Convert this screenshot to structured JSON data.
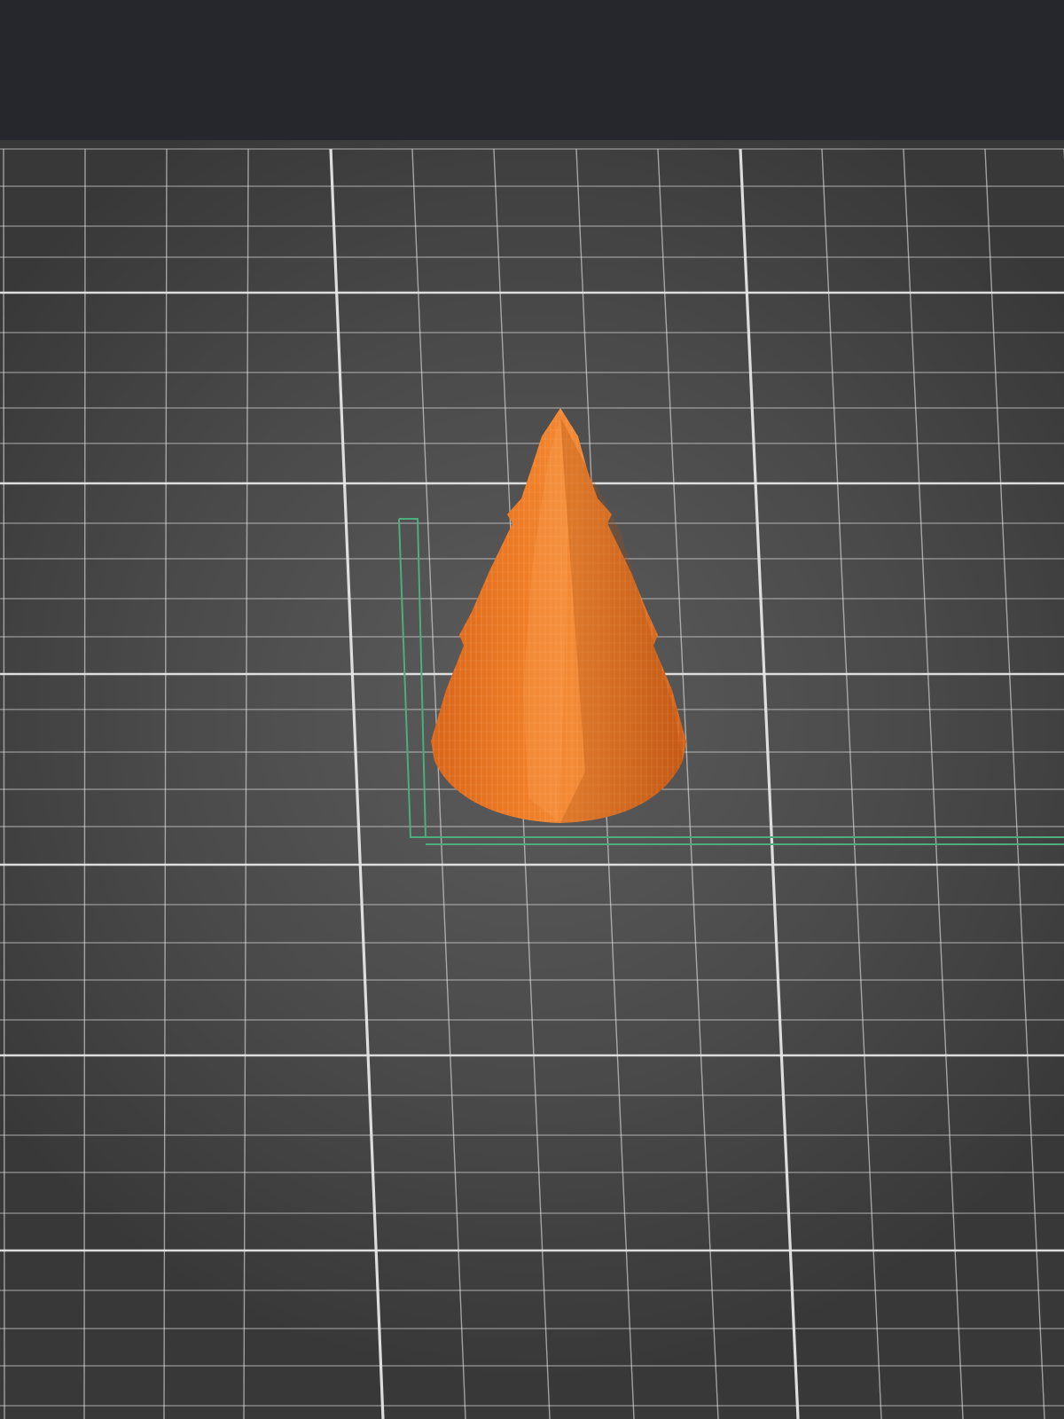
{
  "app": {
    "title": "",
    "top_bar": {
      "background": "#25272c"
    }
  },
  "viewport": {
    "background_center": "#5a5a5a",
    "background_edge": "#3a3a3a",
    "grid_color": "#e6e6e6",
    "axis_color": "#4cae7f",
    "model": {
      "name": "tree-model",
      "icon": "cone-tree",
      "color": "#e8741f",
      "selected": false
    }
  }
}
